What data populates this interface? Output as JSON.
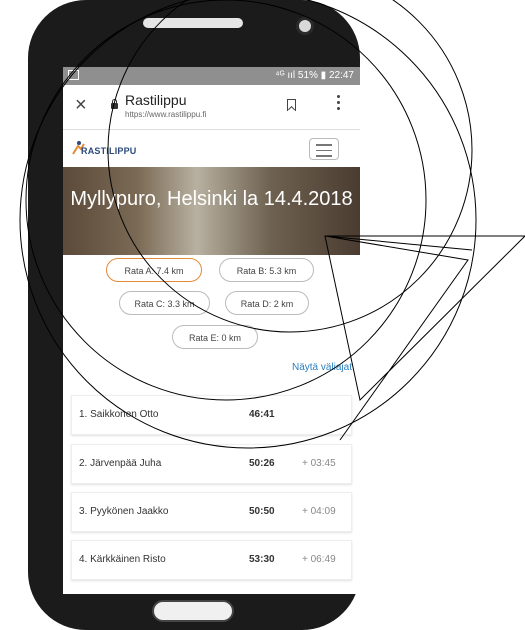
{
  "statusbar": {
    "right": "⁴ᴳ ııl 51% ▮ 22:47"
  },
  "browser": {
    "title": "Rastilippu",
    "url": "https://www.rastilippu.fi"
  },
  "site": {
    "logo_text": "RASTILIPPU"
  },
  "hero": {
    "title": "Myllypuro, Helsinki la 14.4.2018"
  },
  "tabs": [
    {
      "label": "Rata A: 7.4 km",
      "active": true
    },
    {
      "label": "Rata B: 5.3 km",
      "active": false
    },
    {
      "label": "Rata C: 3.3 km",
      "active": false
    },
    {
      "label": "Rata D: 2 km",
      "active": false
    },
    {
      "label": "Rata E: 0 km",
      "active": false
    }
  ],
  "splits_link": "Näytä väliajat",
  "results": [
    {
      "name": "1. Saikkonen Otto",
      "time": "46:41",
      "diff": ""
    },
    {
      "name": "2. Järvenpää Juha",
      "time": "50:26",
      "diff": "+ 03:45"
    },
    {
      "name": "3. Pyykönen Jaakko",
      "time": "50:50",
      "diff": "+ 04:09"
    },
    {
      "name": "4. Kärkkäinen Risto",
      "time": "53:30",
      "diff": "+ 06:49"
    }
  ],
  "colors": {
    "accent": "#e08b3a",
    "link": "#2a7fc0",
    "logo": "#2a4a7a"
  }
}
